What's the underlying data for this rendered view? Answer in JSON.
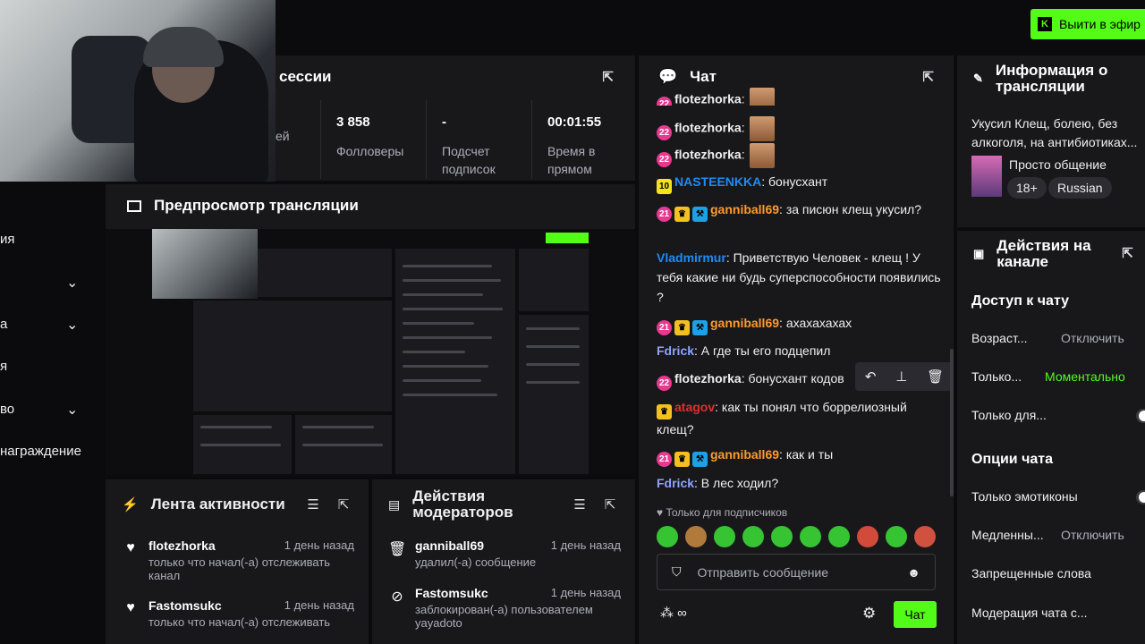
{
  "go_live": {
    "label": "Выити в эфир",
    "icon": "kick-logo-icon"
  },
  "session": {
    "title": "сессии",
    "stats": [
      {
        "value": "",
        "label": "ей"
      },
      {
        "value": "3 858",
        "label": "Фолловеры"
      },
      {
        "value": "-",
        "label": "Подсчет подписок"
      },
      {
        "value": "00:01:55",
        "label": "Время в прямом"
      }
    ]
  },
  "left_nav": {
    "items": [
      "ия",
      "",
      "а",
      "я",
      "во",
      "награждение"
    ]
  },
  "preview": {
    "title": "Предпросмотр трансляции"
  },
  "activity": {
    "title": "Лента активности",
    "items": [
      {
        "name": "flotezhorka",
        "time": "1 день назад",
        "desc": "только что начал(-а) отслеживать канал"
      },
      {
        "name": "Fastomsukc",
        "time": "1 день назад",
        "desc": "только что начал(-а) отслеживать"
      }
    ]
  },
  "mods": {
    "title": "Действия модераторов",
    "items": [
      {
        "name": "ganniball69",
        "time": "1 день назад",
        "desc": "удалил(-а) сообщение",
        "extra": ""
      },
      {
        "name": "Fastomsukc",
        "time": "1 день назад",
        "desc": "заблокирован(-а) пользователем",
        "extra": "yayadoto"
      }
    ]
  },
  "chat": {
    "title": "Чат",
    "messages": [
      {
        "user": "flotezhorka",
        "text": ""
      },
      {
        "user": "flotezhorka",
        "text": ""
      },
      {
        "user": "flotezhorka",
        "text": ""
      },
      {
        "user": "NASTEENKKA",
        "text": "бонусхант"
      },
      {
        "user": "ganniball69",
        "text": "за писюн клещ укусил?"
      },
      {
        "user": "Vladmirmur",
        "text": "Приветствую Человек - клещ ! У тебя какие ни будь суперспособности появились ?"
      },
      {
        "user": "ganniball69",
        "text": "ахахахахах"
      },
      {
        "user": "Fdrick",
        "text": "А где ты его подцепил"
      },
      {
        "user": "flotezhorka",
        "text": "бонусхант кодов"
      },
      {
        "user": "atagov",
        "text": "как ты понял что боррелиозный клещ?"
      },
      {
        "user": "ganniball69",
        "text": "как и ты"
      },
      {
        "user": "Fdrick",
        "text": "В лес ходил?"
      }
    ],
    "subs_only": "Только для подписчиков",
    "input_placeholder": "Отправить сообщение",
    "send_label": "Чат",
    "badge_num_1": "22",
    "badge_num_2": "10",
    "badge_num_3": "21"
  },
  "info": {
    "title": "Информация о трансляции",
    "stream_title": "Укусил Клещ, болею, без алкоголя, на антибиотиках...",
    "category": "Просто общение",
    "tags": [
      "18+",
      "Russian"
    ]
  },
  "actions": {
    "title": "Действия на канале",
    "chat_access": "Доступ к чату",
    "rows": [
      {
        "label": "Возраст...",
        "value": "Отключить"
      },
      {
        "label": "Только...",
        "value": "Моментально"
      },
      {
        "label": "Только для...",
        "value": ""
      }
    ],
    "chat_options": "Опции чата",
    "rows2": [
      {
        "label": "Только эмотиконы",
        "value": ""
      },
      {
        "label": "Медленны...",
        "value": "Отключить"
      },
      {
        "label": "Запрещенные слова",
        "value": ""
      },
      {
        "label": "Модерация чата с...",
        "value": ""
      }
    ]
  },
  "colors": {
    "accent": "#53fc18",
    "panel": "#18181b",
    "background": "#0b0b0d"
  }
}
